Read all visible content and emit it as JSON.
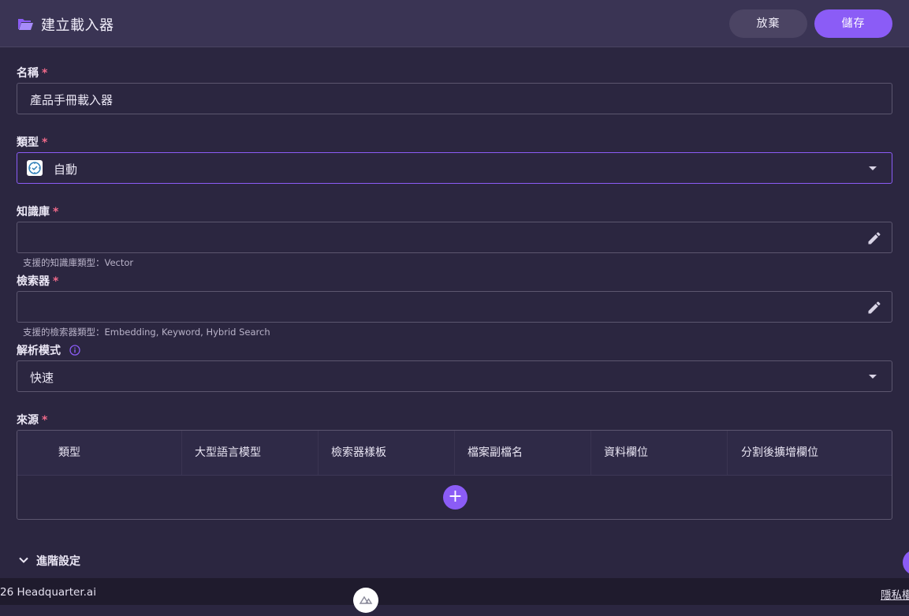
{
  "header": {
    "title": "建立載入器",
    "discard_label": "放棄",
    "save_label": "儲存"
  },
  "form": {
    "name": {
      "label": "名稱",
      "required_mark": "*",
      "value": "產品手冊載入器"
    },
    "type": {
      "label": "類型",
      "required_mark": "*",
      "value": "自動"
    },
    "knowledge_base": {
      "label": "知識庫",
      "required_mark": "*",
      "value": "",
      "hint": "支援的知識庫類型：Vector"
    },
    "retriever": {
      "label": "檢索器",
      "required_mark": "*",
      "value": "",
      "hint": "支援的檢索器類型：Embedding, Keyword, Hybrid Search"
    },
    "parse_mode": {
      "label": "解析模式",
      "value": "快速"
    },
    "sources": {
      "label": "來源",
      "required_mark": "*",
      "columns": [
        "類型",
        "大型語言模型",
        "檢索器樣板",
        "檔案副檔名",
        "資料欄位",
        "分割後擴增欄位"
      ],
      "add_label": "+"
    },
    "advanced_label": "進階設定"
  },
  "footer": {
    "copyright": "26 Headquarter.ai",
    "privacy": "隱私權"
  },
  "colors": {
    "accent": "#8b5cf6",
    "background": "#2b2640",
    "header": "#3a3454",
    "required": "#f06a8a"
  },
  "icons": {
    "header": "folder-open-icon",
    "type": "auto-type-icon",
    "edit": "pencil-icon",
    "info": "info-icon",
    "dropdown": "caret-down-icon",
    "advanced": "chevron-down-icon"
  }
}
